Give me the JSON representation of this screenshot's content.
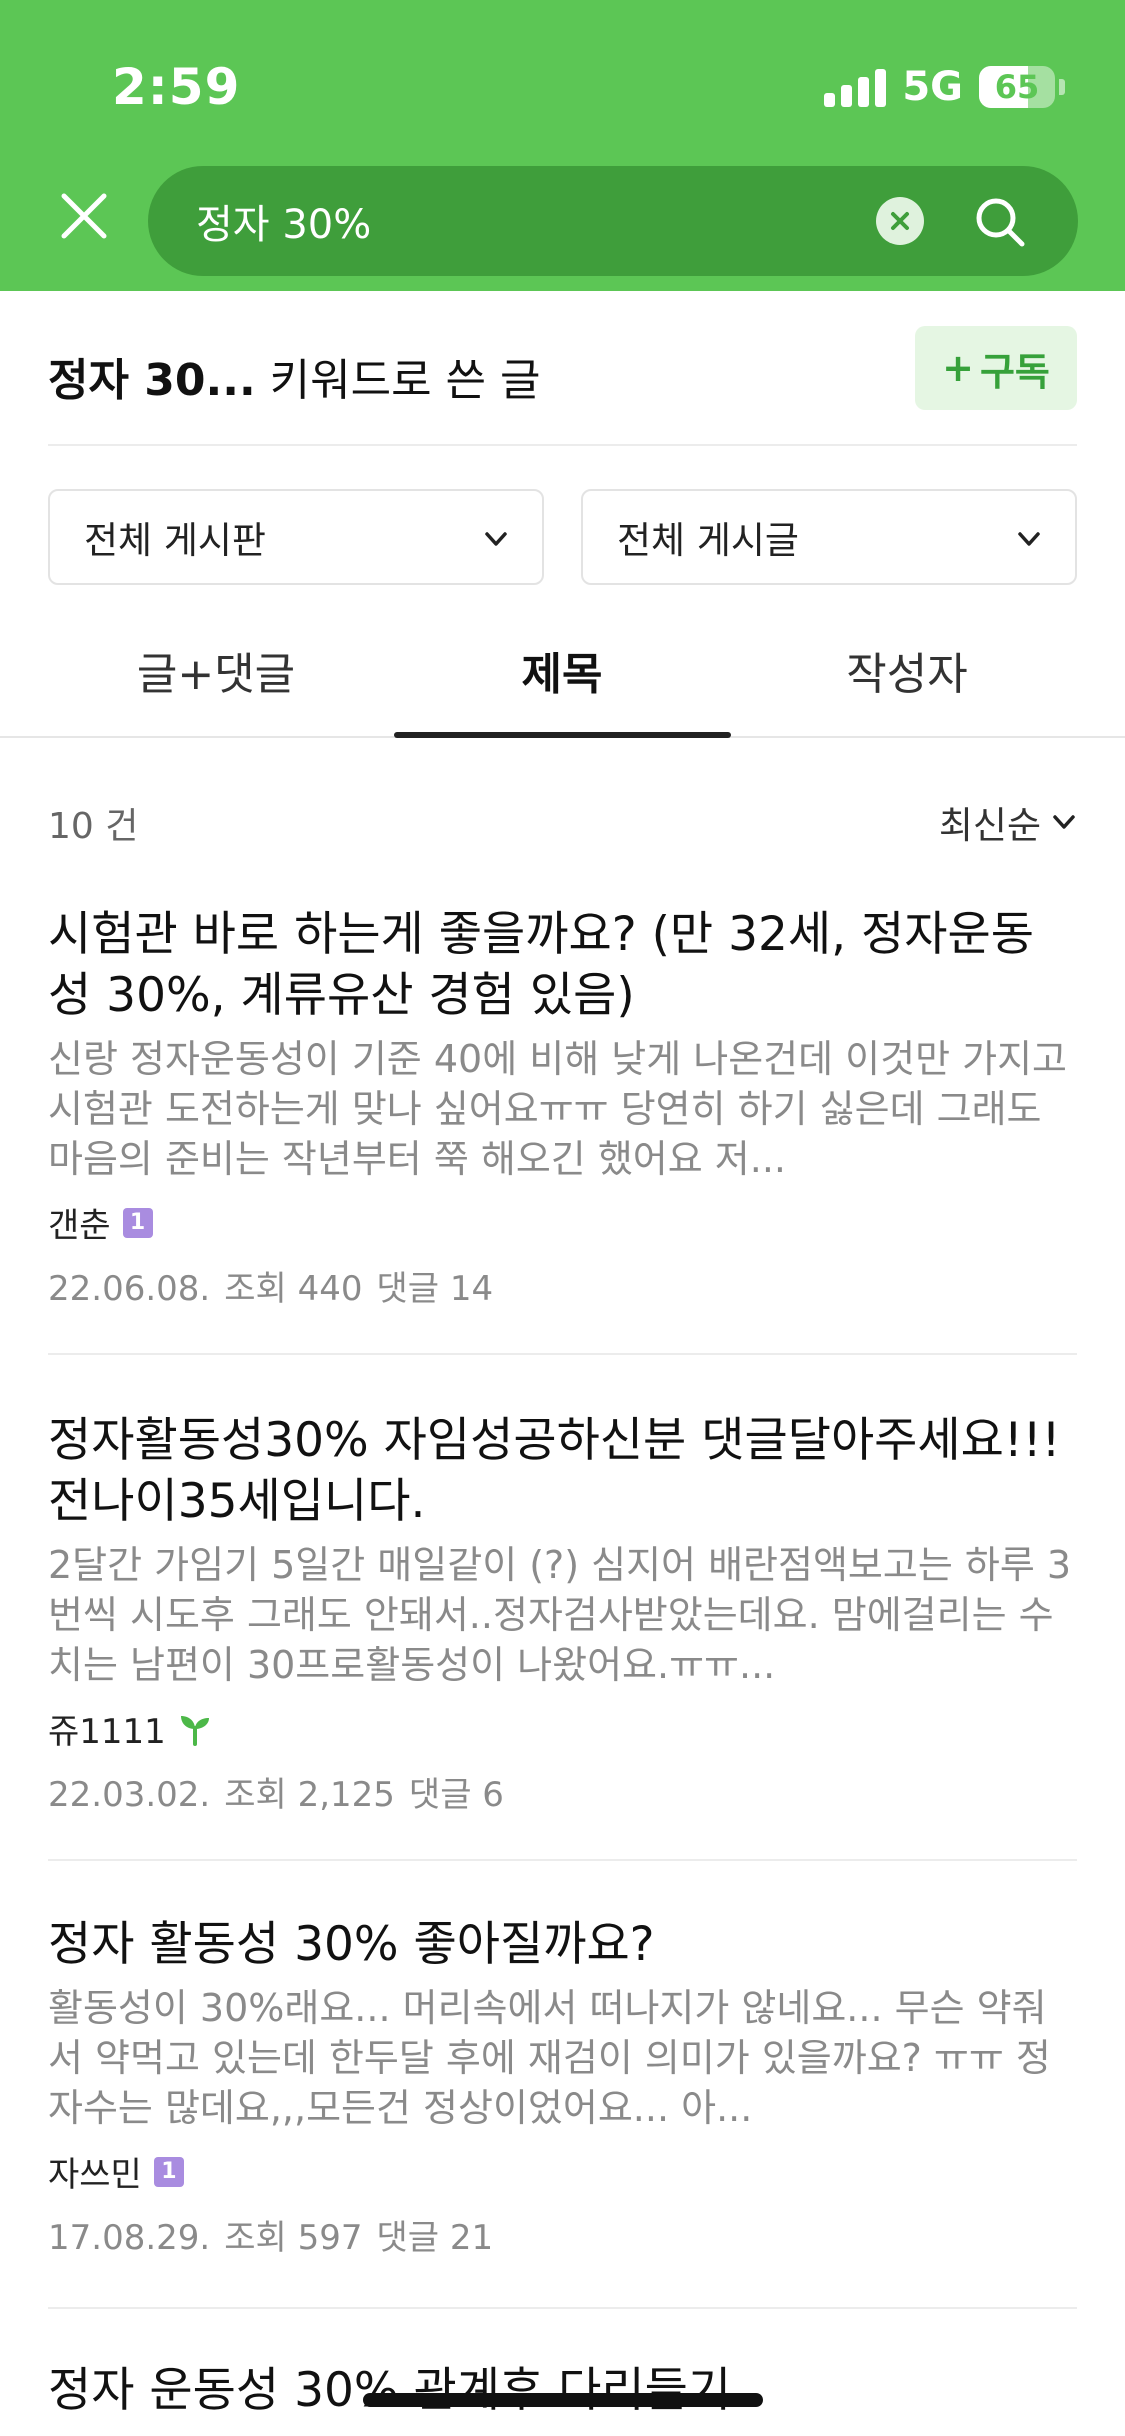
{
  "status_bar": {
    "time": "2:59",
    "network": "5G",
    "battery": "65",
    "battery_level": 0.65
  },
  "search": {
    "query": "정자 30%",
    "close_icon": "close-icon",
    "clear_icon": "clear-circle-icon",
    "search_icon": "search-icon"
  },
  "keyword_header": {
    "keyword": "정자 30...",
    "suffix": " 키워드로 쓴 글",
    "subscribe_label": "구독",
    "subscribe_prefix": "+"
  },
  "filters": {
    "board": "전체 게시판",
    "post_type": "전체 게시글"
  },
  "tabs": [
    {
      "label": "글+댓글"
    },
    {
      "label": "제목"
    },
    {
      "label": "작성자"
    }
  ],
  "active_tab": 1,
  "results": {
    "count": "10 건",
    "sort": "최신순"
  },
  "posts": [
    {
      "title": "시험관 바로 하는게 좋을까요? (만 32세, 정자운동성 30%, 계류유산 경험 있음)",
      "snippet": "신랑 정자운동성이 기준 40에 비해 낮게 나온건데 이것만 가지고 시험관 도전하는게 맞나 싶어요ㅠㅠ 당연히 하기 싫은데 그래도 마음의 준비는 작년부터 쭉 해오긴 했어요 저...",
      "author": "갠춘",
      "badge": "1",
      "date": "22.06.08.",
      "views": "조회 440",
      "comments": "댓글 14"
    },
    {
      "title": "정자활동성30% 자임성공하신분 댓글달아주세요!!! 전나이35세입니다.",
      "snippet": "2달간 가임기 5일간 매일같이 (?) 심지어 배란점액보고는 하루 3번씩 시도후 그래도 안돼서..정자검사받았는데요. 맘에걸리는 수치는 남편이 30프로활동성이 나왔어요.ㅠㅠ...",
      "author": "쥬1111",
      "badge": "",
      "date": "22.03.02.",
      "views": "조회 2,125",
      "comments": "댓글 6"
    },
    {
      "title": "정자 활동성 30% 좋아질까요?",
      "snippet": "활동성이 30%래요... 머리속에서 떠나지가 않네요... 무슨 약줘서 약먹고 있는데 한두달 후에 재검이 의미가 있을까요? ㅠㅠ 정자수는 많데요,,,모든건 정상이었어요... 아...",
      "author": "자쓰민",
      "badge": "1",
      "date": "17.08.29.",
      "views": "조회 597",
      "comments": "댓글 21"
    },
    {
      "title": "정자 운동성 30% 관계후 다리들기"
    }
  ],
  "colors": {
    "brand_green": "#5cc655",
    "search_green": "#3f9e3b",
    "subscribe_bg": "#e5f6e3",
    "subscribe_text": "#36a13a",
    "badge_purple": "#a98ce0",
    "sprout_green": "#4cb848"
  }
}
